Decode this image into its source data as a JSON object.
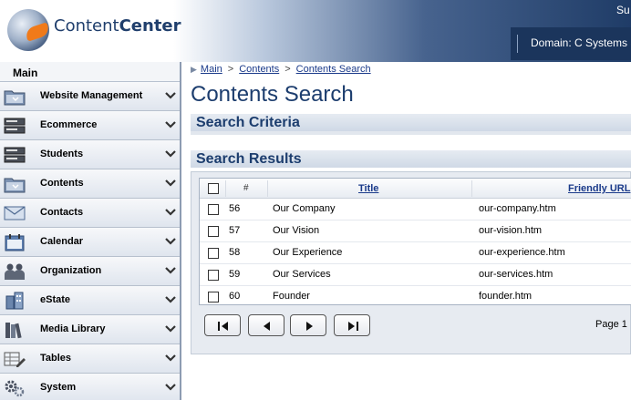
{
  "header": {
    "brand_light": "Content",
    "brand_bold": "Center",
    "user_text": "Su",
    "domain_text": "Domain: C Systems S"
  },
  "sidebar": {
    "title": "Main",
    "items": [
      {
        "label": "Website Management",
        "icon": "folder-icon"
      },
      {
        "label": "Ecommerce",
        "icon": "server-icon"
      },
      {
        "label": "Students",
        "icon": "server-icon"
      },
      {
        "label": "Contents",
        "icon": "folder-icon"
      },
      {
        "label": "Contacts",
        "icon": "envelope-icon"
      },
      {
        "label": "Calendar",
        "icon": "calendar-icon"
      },
      {
        "label": "Organization",
        "icon": "people-icon"
      },
      {
        "label": "eState",
        "icon": "building-icon"
      },
      {
        "label": "Media Library",
        "icon": "books-icon"
      },
      {
        "label": "Tables",
        "icon": "table-pencil-icon"
      },
      {
        "label": "System",
        "icon": "gears-icon"
      }
    ]
  },
  "breadcrumb": [
    "Main",
    "Contents",
    "Contents Search"
  ],
  "page_title": "Contents Search",
  "sections": {
    "criteria": "Search Criteria",
    "results": "Search Results"
  },
  "grid": {
    "headers": {
      "hash": "#",
      "title": "Title",
      "url": "Friendly URL"
    },
    "rows": [
      {
        "id": "56",
        "title": "Our Company",
        "url": "our-company.htm"
      },
      {
        "id": "57",
        "title": "Our Vision",
        "url": "our-vision.htm"
      },
      {
        "id": "58",
        "title": "Our Experience",
        "url": "our-experience.htm"
      },
      {
        "id": "59",
        "title": "Our Services",
        "url": "our-services.htm"
      },
      {
        "id": "60",
        "title": "Founder",
        "url": "founder.htm"
      }
    ]
  },
  "pager": {
    "page_label": "Page 1"
  },
  "colors": {
    "brand_blue": "#1c3d6e",
    "link_blue": "#1a3a8a",
    "accent_orange": "#f07a1a"
  }
}
